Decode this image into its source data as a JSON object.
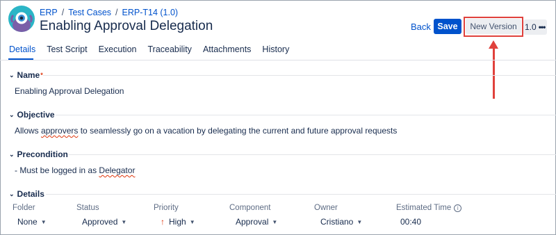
{
  "breadcrumb": {
    "project": "ERP",
    "section": "Test Cases",
    "item": "ERP-T14 (1.0)"
  },
  "page_title": "Enabling Approval Delegation",
  "toolbar": {
    "back_label": "Back",
    "save_label": "Save",
    "new_version_label": "New Version",
    "version_label": "1.0",
    "more_label": "•••"
  },
  "tabs": [
    {
      "label": "Details",
      "active": true
    },
    {
      "label": "Test Script"
    },
    {
      "label": "Execution"
    },
    {
      "label": "Traceability"
    },
    {
      "label": "Attachments"
    },
    {
      "label": "History"
    }
  ],
  "sections": {
    "name": {
      "title": "Name",
      "required_mark": "*",
      "value": "Enabling Approval Delegation"
    },
    "objective": {
      "title": "Objective",
      "value_before": "Allows ",
      "value_flagged": "approvers",
      "value_after": " to seamlessly go on a vacation by delegating the current and future approval requests"
    },
    "precondition": {
      "title": "Precondition",
      "value_before": "- Must be logged in as ",
      "value_flagged": "Delegator"
    },
    "details": {
      "title": "Details"
    }
  },
  "details_fields": [
    {
      "label": "Folder",
      "value": "None"
    },
    {
      "label": "Status",
      "value": "Approved"
    },
    {
      "label": "Priority",
      "value": "High",
      "icon": "arrow-up-icon"
    },
    {
      "label": "Component",
      "value": "Approval"
    },
    {
      "label": "Owner",
      "value": "Cristiano"
    },
    {
      "label": "Estimated Time",
      "value": "00:40",
      "icon": "info-icon"
    }
  ],
  "colors": {
    "accent": "#0052cc",
    "annotation": "#e0413c",
    "avatar": "#2bb5c6"
  }
}
